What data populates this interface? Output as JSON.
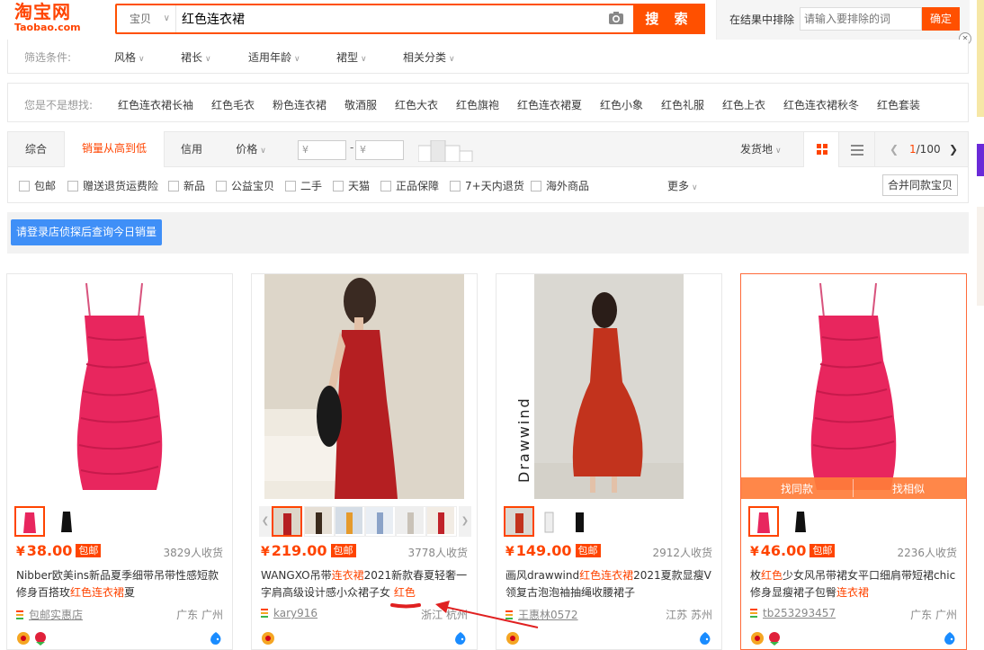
{
  "logo": {
    "cn": "淘宝网",
    "en": "Taobao.com"
  },
  "search": {
    "type": "宝贝",
    "query": "红色连衣裙",
    "button": "搜 索"
  },
  "exclude": {
    "label": "在结果中排除",
    "placeholder": "请输入要排除的词",
    "button": "确定",
    "close": "×"
  },
  "filters": {
    "label": "筛选条件:",
    "items": [
      "风格",
      "裙长",
      "适用年龄",
      "裙型",
      "相关分类"
    ]
  },
  "suggest": {
    "label": "您是不是想找:",
    "items": [
      "红色连衣裙长袖",
      "红色毛衣",
      "粉色连衣裙",
      "敬酒服",
      "红色大衣",
      "红色旗袍",
      "红色连衣裙夏",
      "红色小象",
      "红色礼服",
      "红色上衣",
      "红色连衣裙秋冬",
      "红色套装"
    ]
  },
  "sort": {
    "tabs": [
      "综合",
      "销量从高到低",
      "信用",
      "价格"
    ],
    "active": "销量从高到低",
    "price_from": "¥",
    "price_to": "¥",
    "dash": "-",
    "ship_from": "发货地",
    "page_current": "1",
    "page_total": "/100"
  },
  "checks": {
    "items": [
      "包邮",
      "赠送退货运费险",
      "新品",
      "公益宝贝",
      "二手",
      "天猫",
      "正品保障",
      "7+天内退货",
      "海外商品"
    ],
    "more": "更多",
    "merge": "合并同款宝贝"
  },
  "login_banner": "请登录店侦探后查询今日销量",
  "products": [
    {
      "price": "38.00",
      "yen": "¥",
      "baoyou": "包邮",
      "sold": "3829人收货",
      "title_parts": [
        "Nibber欧美ins新品夏季细带吊带性感短款修身百搭玫",
        "红色连衣裙",
        "夏"
      ],
      "shop": "包邮实惠店",
      "location": "广东 广州"
    },
    {
      "price": "219.00",
      "yen": "¥",
      "baoyou": "包邮",
      "sold": "3778人收货",
      "title_parts": [
        "WANGXO吊带",
        "连衣裙",
        "2021新款春夏轻奢一字肩高级设计感小众裙子女 ",
        "红色",
        ""
      ],
      "shop": "kary916",
      "location": "浙江 杭州"
    },
    {
      "price": "149.00",
      "yen": "¥",
      "baoyou": "包邮",
      "sold": "2912人收货",
      "title_parts": [
        "画风drawwind",
        "红色连衣裙",
        "2021夏款显瘦V领复古泡泡袖抽绳收腰裙子"
      ],
      "shop": "王惠林0572",
      "location": "江苏 苏州",
      "image_text": "Drawwind"
    },
    {
      "price": "46.00",
      "yen": "¥",
      "baoyou": "包邮",
      "sold": "2236人收货",
      "title_parts": [
        "枚",
        "红色",
        "少女风吊带裙女平口细肩带短裙chic修身显瘦裙子包臀",
        "连衣裙"
      ],
      "shop": "tb253293457",
      "location": "广东 广州",
      "hover_left": "找同款",
      "hover_right": "找相似"
    }
  ],
  "colors": {
    "accent": "#ff4400",
    "brand_orange": "#ff5000",
    "login_blue": "#3f8ff7",
    "dress_pink": "#e8265e",
    "dress_red": "#b81f24",
    "annotation_red": "#e02020"
  }
}
